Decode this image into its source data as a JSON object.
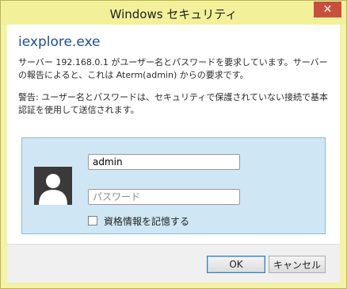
{
  "window": {
    "title": "Windows セキュリティ",
    "close_label": "✕",
    "accent": "#f3f09a",
    "close_color": "#c7503c"
  },
  "dialog": {
    "app_name": "iexplore.exe",
    "description": "サーバー 192.168.0.1 がユーザー名とパスワードを要求しています。サーバーの報告によると、これは Aterm(admin) からの要求です。",
    "warning": "警告: ユーザー名とパスワードは、セキュリティで保護されていない接続で基本認証を使用して送信されます。"
  },
  "credentials": {
    "avatar_icon": "user-silhouette-icon",
    "username_value": "admin",
    "password_placeholder": "パスワード",
    "remember_label": "資格情報を記憶する",
    "remember_checked": false
  },
  "buttons": {
    "ok_label": "OK",
    "cancel_label": "キャンセル"
  }
}
